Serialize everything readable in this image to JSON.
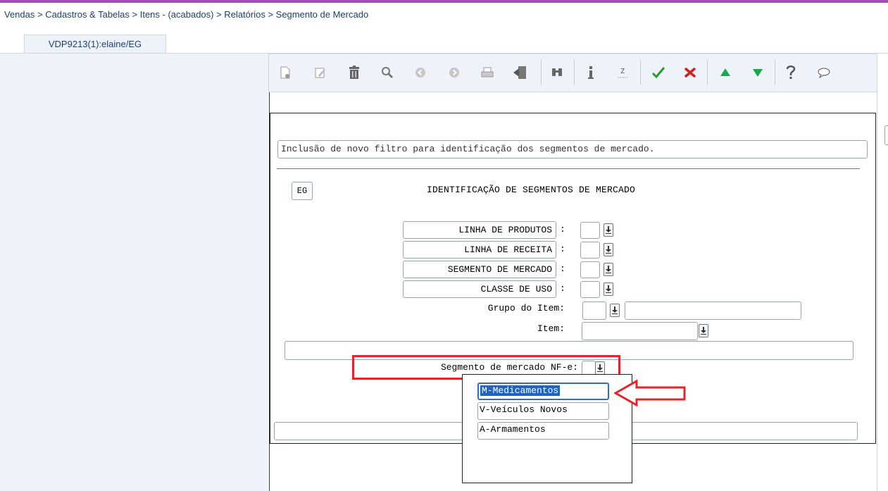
{
  "breadcrumb": "Vendas > Cadastros & Tabelas > Itens - (acabados) > Relatórios > Segmento de Mercado",
  "tab": {
    "label": "VDP9213(1):elaine/EG"
  },
  "toolbar": {
    "buttons": [
      "new-icon",
      "edit-icon",
      "delete-icon",
      "search-icon",
      "previous-icon",
      "next-icon",
      "print-icon",
      "exit-icon",
      "find-icon",
      "info-icon",
      "zoom-icon",
      "confirm-icon",
      "cancel-icon",
      "up-icon",
      "down-icon",
      "help-icon",
      "chat-icon"
    ],
    "colors": {
      "confirm": "#2a9b2a",
      "cancel": "#d11f1f",
      "up": "#19a84b",
      "down": "#19a84b",
      "icon": "#6b6b6b"
    }
  },
  "form": {
    "description": "Inclusão de novo filtro para identificação dos segmentos de mercado.",
    "company_code": "EG",
    "title": "IDENTIFICAÇÃO DE SEGMENTOS DE MERCADO",
    "fields": [
      {
        "label": "LINHA DE PRODUTOS",
        "colon": ":",
        "value": ""
      },
      {
        "label": "LINHA DE RECEITA",
        "colon": ":",
        "value": ""
      },
      {
        "label": "SEGMENTO DE MERCADO",
        "colon": ":",
        "value": ""
      },
      {
        "label": "CLASSE DE USO",
        "colon": ":",
        "value": ""
      }
    ],
    "grupo_item": {
      "label": "Grupo do Item:",
      "value": "",
      "description": ""
    },
    "item": {
      "label": "Item:",
      "value": ""
    },
    "segmento_nfe": {
      "label": "Segmento de mercado NF-e:",
      "value": ""
    }
  },
  "dropdown": {
    "options": [
      "M-Medicamentos",
      "V-Veículos Novos",
      "A-Armamentos"
    ],
    "selected": "M-Medicamentos"
  },
  "annotation_colors": {
    "highlight": "#e5242b",
    "arrow": "#e5242b"
  }
}
